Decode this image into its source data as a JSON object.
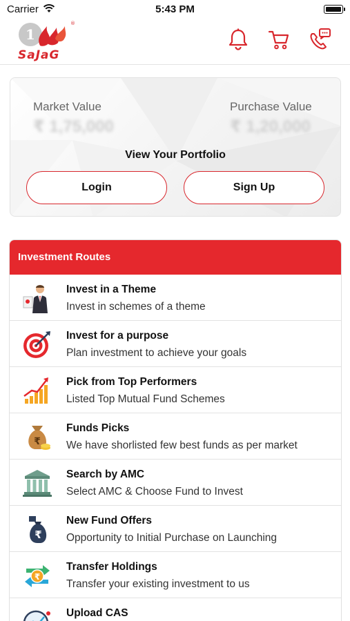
{
  "status_bar": {
    "carrier": "Carrier",
    "time": "5:43 PM"
  },
  "header": {
    "logo_text": "SaJaG",
    "logo_mark": "1",
    "icons": [
      "bell-icon",
      "cart-icon",
      "support-chat-icon"
    ],
    "brand_color": "#d8262c"
  },
  "portfolio": {
    "market_value_label": "Market Value",
    "market_value": "₹ 1,75,000",
    "purchase_value_label": "Purchase Value",
    "purchase_value": "₹ 1,20,000",
    "view_label": "View Your Portfolio",
    "login_label": "Login",
    "signup_label": "Sign Up"
  },
  "routes": {
    "heading": "Investment Routes",
    "header_color": "#e5282d",
    "items": [
      {
        "title": "Invest in a Theme",
        "subtitle": "Invest in schemes of a theme",
        "icon": "businessman-icon"
      },
      {
        "title": "Invest for a purpose",
        "subtitle": "Plan investment to achieve your goals",
        "icon": "target-icon"
      },
      {
        "title": "Pick from Top Performers",
        "subtitle": "Listed Top Mutual Fund Schemes",
        "icon": "growth-chart-icon"
      },
      {
        "title": "Funds Picks",
        "subtitle": "We have shorlisted few best funds as per market",
        "icon": "money-bag-icon"
      },
      {
        "title": "Search by AMC",
        "subtitle": "Select AMC & Choose Fund to Invest",
        "icon": "bank-icon"
      },
      {
        "title": "New Fund Offers",
        "subtitle": "Opportunity to Initial Purchase on Launching",
        "icon": "rupee-bag-icon"
      },
      {
        "title": "Transfer Holdings",
        "subtitle": "Transfer your existing investment to us",
        "icon": "transfer-icon"
      },
      {
        "title": "Upload CAS",
        "subtitle": "",
        "icon": "upload-cas-icon"
      }
    ]
  }
}
